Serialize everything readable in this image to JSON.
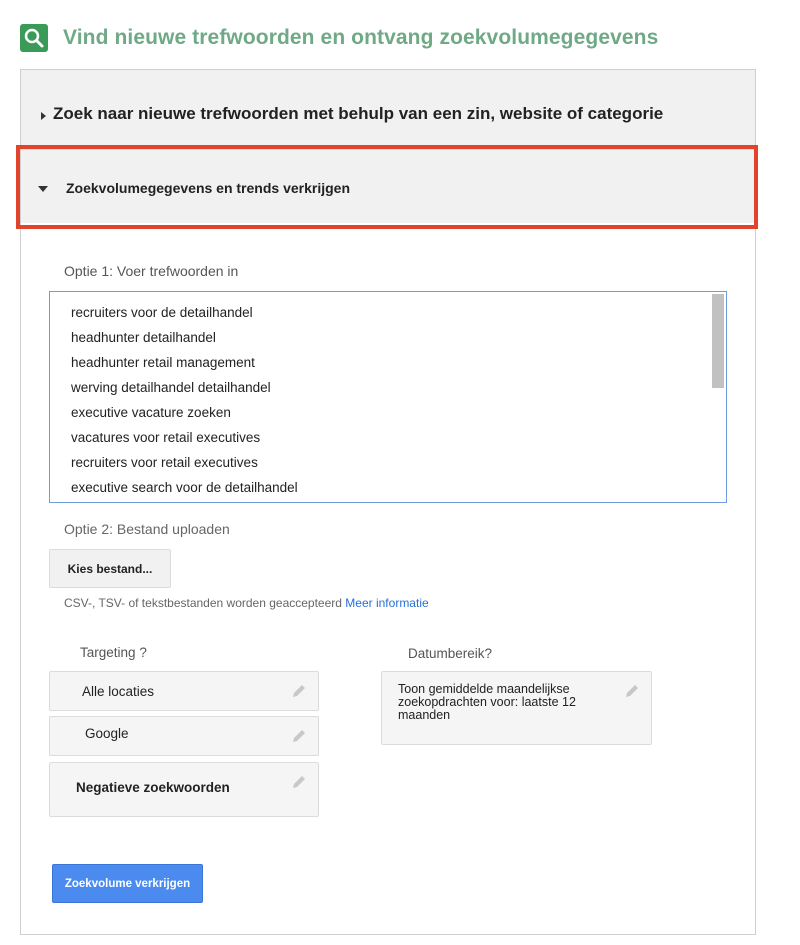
{
  "header": {
    "title": "Vind nieuwe trefwoorden en ontvang zoekvolumegegevens",
    "icon": "search-doc-icon",
    "brand_color": "#3a9a58"
  },
  "sections": {
    "find_keywords": {
      "label": "Zoek naar nieuwe trefwoorden met behulp van een zin, website of categorie",
      "expanded": false
    },
    "search_volume": {
      "label": "Zoekvolumegegevens en trends verkrijgen",
      "expanded": true
    }
  },
  "option1": {
    "label": "Optie 1: Voer trefwoorden in",
    "keywords": [
      "recruiters voor de detailhandel",
      "headhunter detailhandel",
      "headhunter retail management",
      "werving detailhandel detailhandel",
      "executive vacature zoeken",
      "vacatures voor retail executives",
      "recruiters voor retail executives",
      "executive search voor de detailhandel"
    ]
  },
  "option2": {
    "label": "Optie 2: Bestand uploaden",
    "button": "Kies bestand...",
    "note": "CSV-, TSV- of tekstbestanden worden geaccepteerd",
    "link": "Meer informatie"
  },
  "targeting": {
    "label": "Targeting",
    "help": "?",
    "locations": "Alle locaties",
    "network": "Google",
    "negative": "Negatieve zoekwoorden"
  },
  "date_range": {
    "label": "Datumbereik?",
    "value": "Toon gemiddelde maandelijkse zoekopdrachten voor: laatste 12 maanden"
  },
  "submit_label": "Zoekvolume verkrijgen",
  "colors": {
    "highlight": "#e2432c",
    "link": "#2a6fd6",
    "primary_button": "#4b8bf0",
    "title": "#6fa985"
  }
}
